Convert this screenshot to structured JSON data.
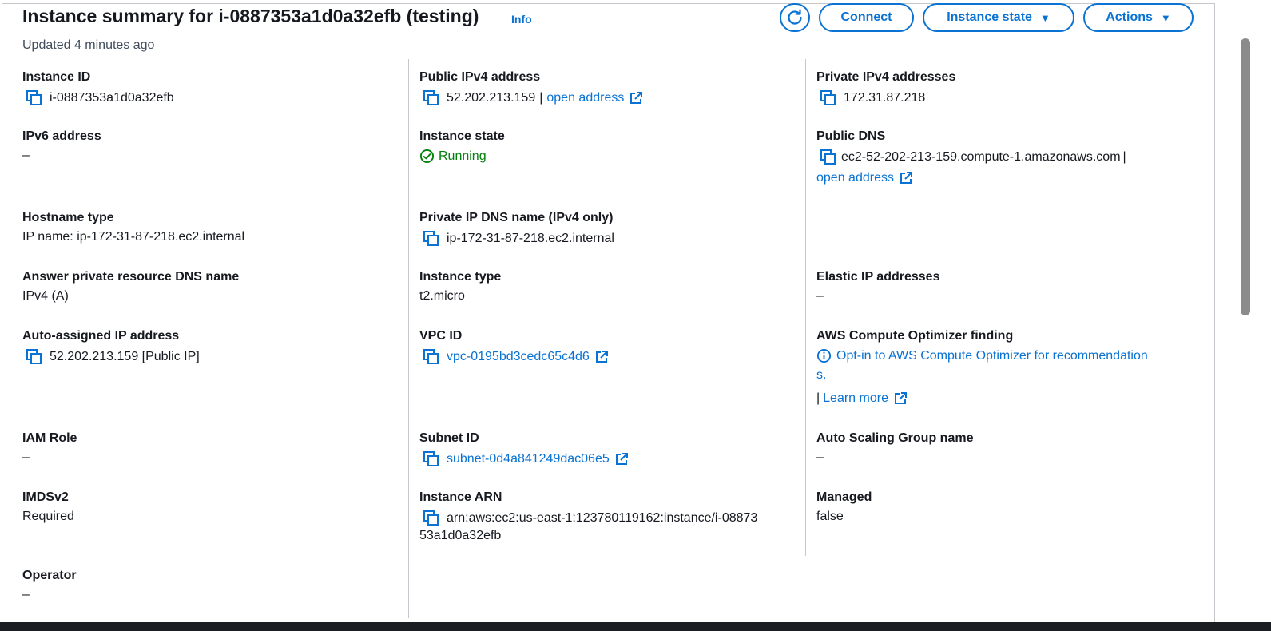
{
  "header": {
    "title": "Instance summary for i-0887353a1d0a32efb (testing)",
    "info_link": "Info",
    "updated": "Updated 4 minutes ago",
    "buttons": {
      "connect": "Connect",
      "instance_state": "Instance state",
      "actions": "Actions"
    }
  },
  "details": {
    "instance_id": {
      "label": "Instance ID",
      "value": "i-0887353a1d0a32efb"
    },
    "public_ipv4": {
      "label": "Public IPv4 address",
      "value": "52.202.213.159",
      "separator": "|",
      "link": "open address"
    },
    "private_ipv4": {
      "label": "Private IPv4 addresses",
      "value": "172.31.87.218"
    },
    "ipv6": {
      "label": "IPv6 address",
      "value": "–"
    },
    "instance_state": {
      "label": "Instance state",
      "value": "Running"
    },
    "public_dns": {
      "label": "Public DNS",
      "value": "ec2-52-202-213-159.compute-1.amazonaws.com",
      "separator": "|",
      "link": "open address"
    },
    "hostname_type": {
      "label": "Hostname type",
      "value": "IP name: ip-172-31-87-218.ec2.internal"
    },
    "private_ip_dns": {
      "label": "Private IP DNS name (IPv4 only)",
      "value": "ip-172-31-87-218.ec2.internal"
    },
    "answer_private_dns": {
      "label": "Answer private resource DNS name",
      "value": "IPv4 (A)"
    },
    "instance_type": {
      "label": "Instance type",
      "value": "t2.micro"
    },
    "elastic_ip": {
      "label": "Elastic IP addresses",
      "value": "–"
    },
    "auto_assigned_ip": {
      "label": "Auto-assigned IP address",
      "value": "52.202.213.159 [Public IP]"
    },
    "vpc_id": {
      "label": "VPC ID",
      "value": "vpc-0195bd3cedc65c4d6"
    },
    "compute_optimizer": {
      "label": "AWS Compute Optimizer finding",
      "value_line1": "Opt-in to AWS Compute Optimizer for recommendation",
      "value_line2": "s.",
      "separator": "|",
      "link": "Learn more"
    },
    "iam_role": {
      "label": "IAM Role",
      "value": "–"
    },
    "subnet_id": {
      "label": "Subnet ID",
      "value": "subnet-0d4a841249dac06e5"
    },
    "asg_name": {
      "label": "Auto Scaling Group name",
      "value": "–"
    },
    "imdsv2": {
      "label": "IMDSv2",
      "value": "Required"
    },
    "instance_arn": {
      "label": "Instance ARN",
      "value_line1": "arn:aws:ec2:us-east-1:123780119162:instance/i-08873",
      "value_line2": "53a1d0a32efb"
    },
    "managed": {
      "label": "Managed",
      "value": "false"
    },
    "operator": {
      "label": "Operator",
      "value": "–"
    }
  },
  "colors": {
    "accent": "#0972d3",
    "success": "#037f0c",
    "text": "#16191f",
    "divider": "#c6c6cd"
  },
  "icons": [
    "refresh-icon",
    "caret-down-icon",
    "copy-icon",
    "external-link-icon",
    "status-success-icon",
    "info-icon"
  ]
}
